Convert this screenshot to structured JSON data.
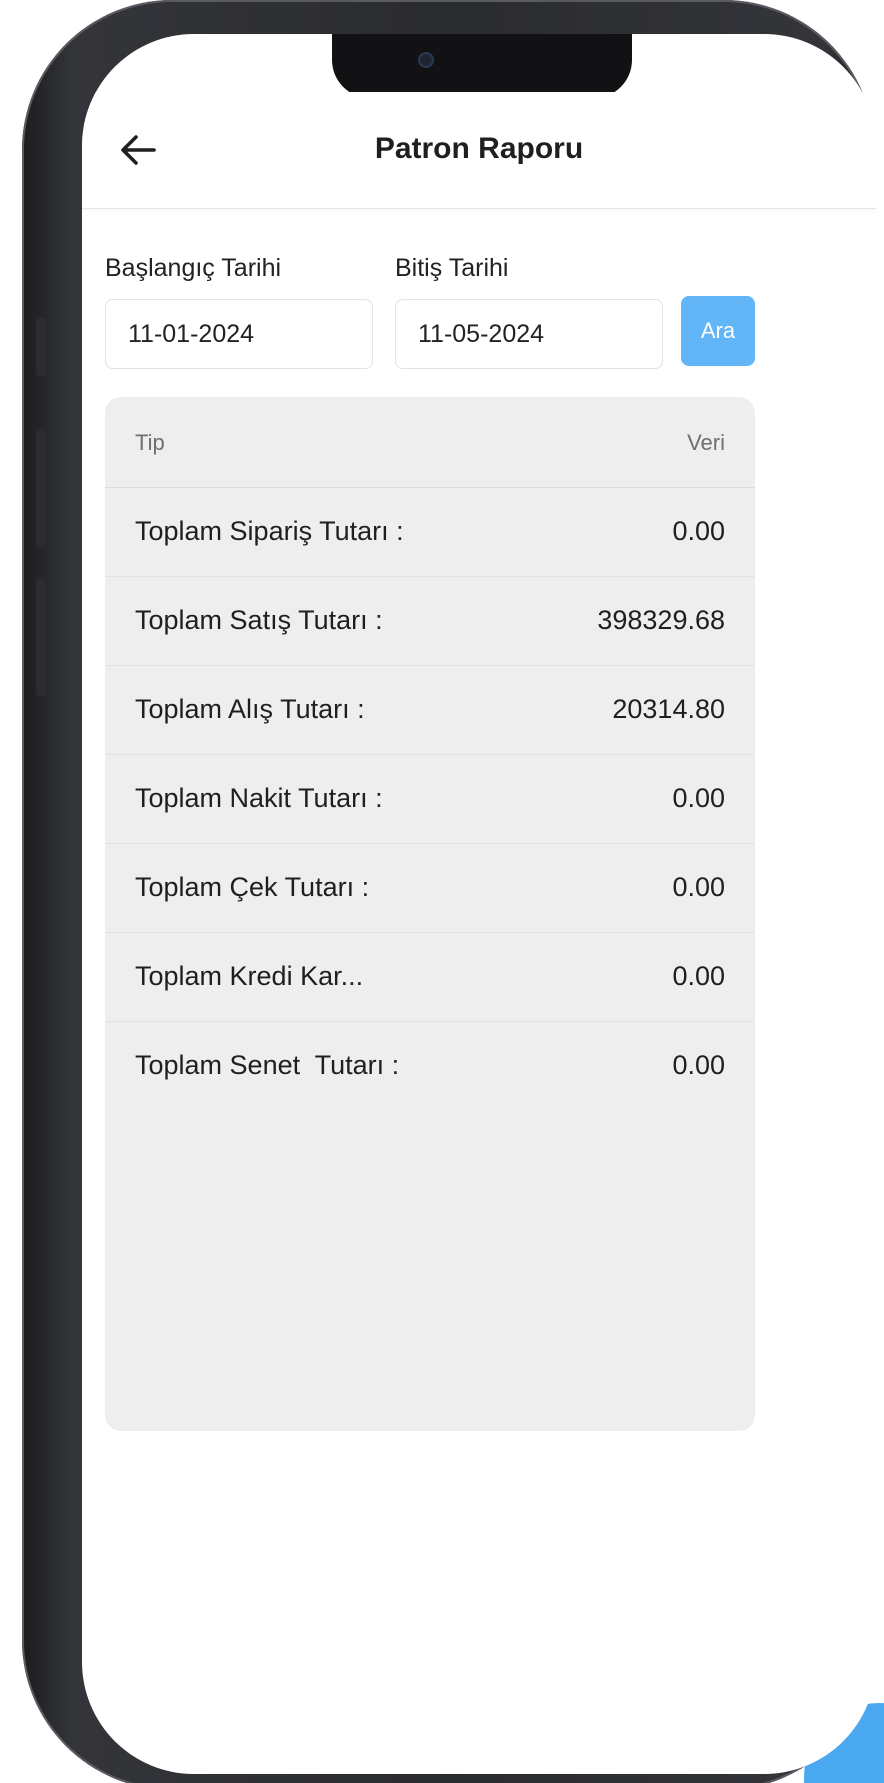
{
  "header": {
    "title": "Patron Raporu",
    "back_icon": "arrow-left-icon"
  },
  "filters": {
    "start_label": "Başlangıç Tarihi",
    "start_value": "11-01-2024",
    "end_label": "Bitiş Tarihi",
    "end_value": "11-05-2024",
    "search_label": "Ara"
  },
  "table": {
    "col_type": "Tip",
    "col_value": "Veri",
    "rows": [
      {
        "label": "Toplam Sipariş Tutarı :",
        "value": "0.00"
      },
      {
        "label": "Toplam Satış Tutarı :",
        "value": "398329.68"
      },
      {
        "label": "Toplam Alış Tutarı :",
        "value": "20314.80"
      },
      {
        "label": "Toplam Nakit Tutarı :",
        "value": "0.00"
      },
      {
        "label": "Toplam Çek Tutarı :",
        "value": "0.00"
      },
      {
        "label": "Toplam Kredi Kar...",
        "value": "0.00"
      },
      {
        "label": "Toplam Senet  Tutarı :",
        "value": "0.00"
      }
    ]
  },
  "colors": {
    "accent": "#62b5f6",
    "card_bg": "#eeeeee",
    "frame": "#2a2b2f"
  }
}
